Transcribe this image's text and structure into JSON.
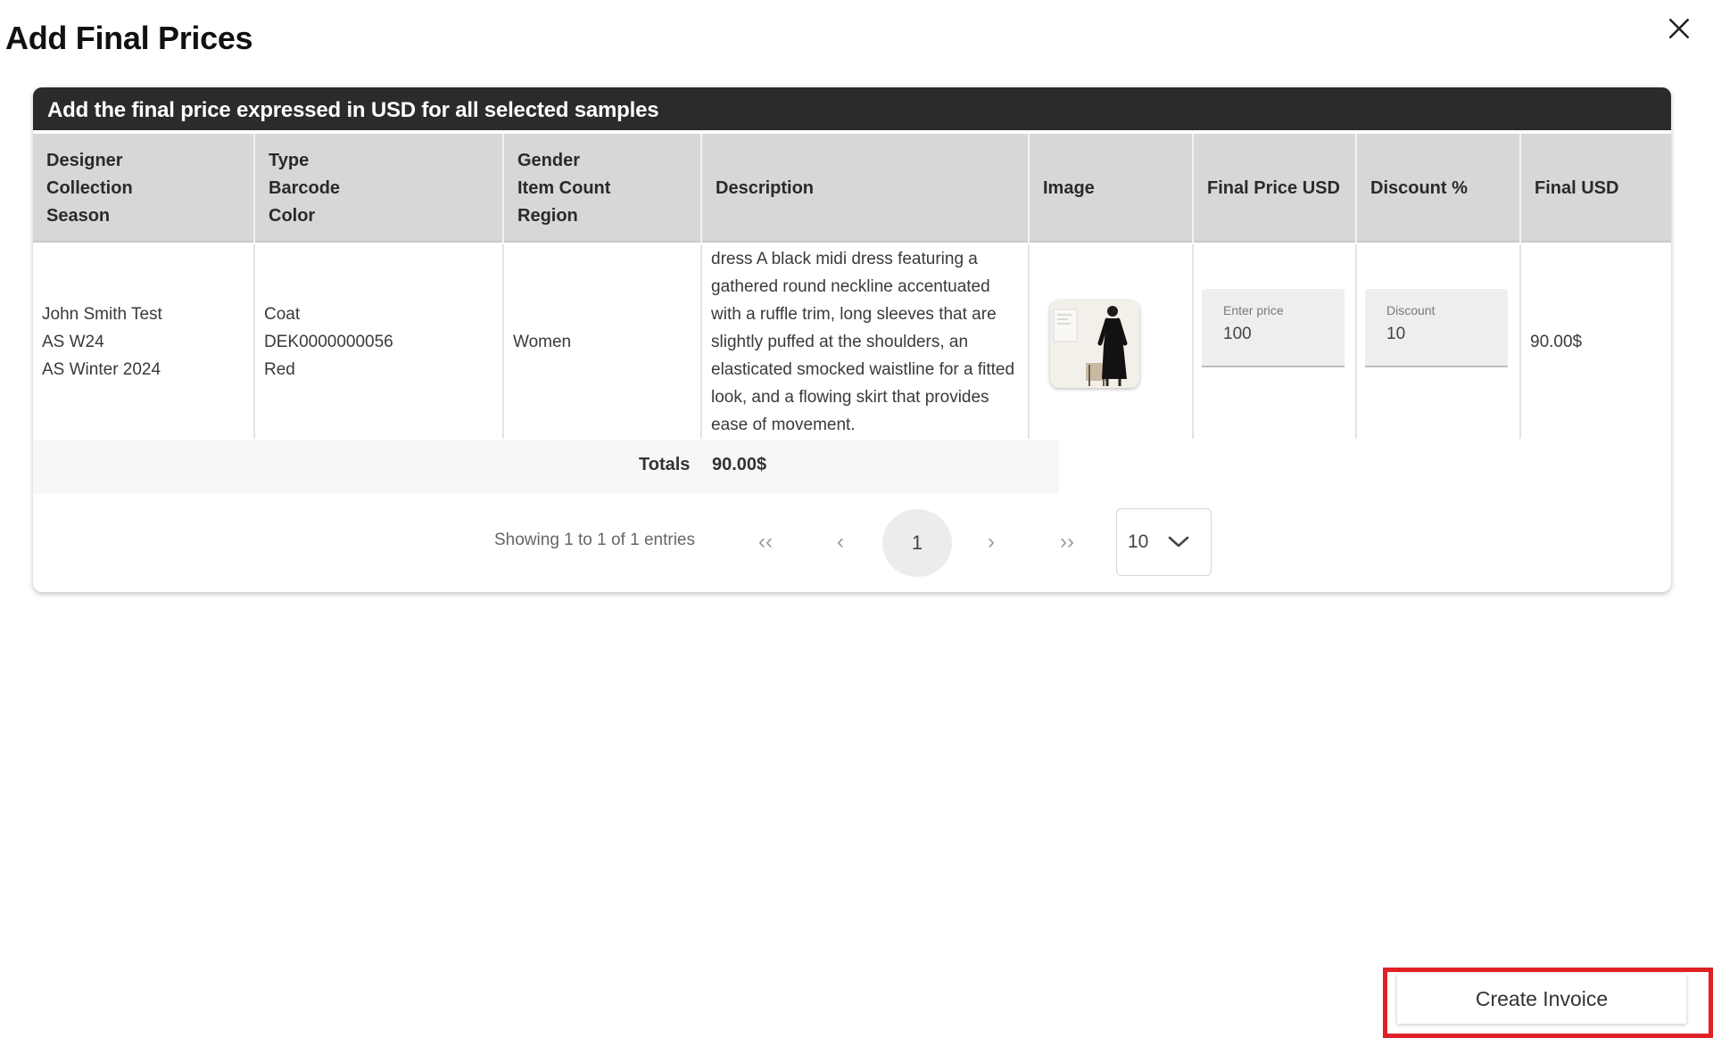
{
  "modal": {
    "title": "Add Final Prices",
    "close_icon": "close-icon"
  },
  "card": {
    "header": "Add the final price expressed in USD for all selected samples"
  },
  "columns": [
    {
      "lines": [
        "Designer",
        "Collection",
        "Season"
      ]
    },
    {
      "lines": [
        "Type",
        "Barcode",
        "Color"
      ]
    },
    {
      "lines": [
        "Gender",
        "Item Count",
        "Region"
      ]
    },
    {
      "lines": [
        "Description"
      ]
    },
    {
      "lines": [
        "Image"
      ]
    },
    {
      "lines": [
        "Final Price USD"
      ]
    },
    {
      "lines": [
        "Discount %"
      ]
    },
    {
      "lines": [
        "Final USD"
      ]
    }
  ],
  "row": {
    "designer": "John Smith Test",
    "collection": "AS W24",
    "season": "AS Winter 2024",
    "type": "Coat",
    "barcode": "DEK0000000056",
    "color": "Red",
    "gender": "Women",
    "description": "dress A black midi dress featuring a gathered round neckline accentuated with a ruffle trim, long sleeves that are slightly puffed at the shoulders, an elasticated smocked waistline for a fitted look, and a flowing skirt that provides ease of movement.",
    "image_icon": "dress-thumbnail-image",
    "price_label": "Enter price",
    "price_value": "100",
    "discount_label": "Discount",
    "discount_value": "10",
    "final_usd": "90.00$"
  },
  "totals": {
    "label": "Totals",
    "value": "90.00$"
  },
  "pagination": {
    "info": "Showing 1 to 1 of 1 entries",
    "first": "‹‹",
    "prev": "‹",
    "current": "1",
    "next": "›",
    "last": "››",
    "page_size": "10"
  },
  "footer": {
    "create_invoice": "Create Invoice"
  },
  "colors": {
    "header_bg": "#2b2b2b",
    "table_head_bg": "#d7d7d7",
    "highlight": "#e02027"
  }
}
